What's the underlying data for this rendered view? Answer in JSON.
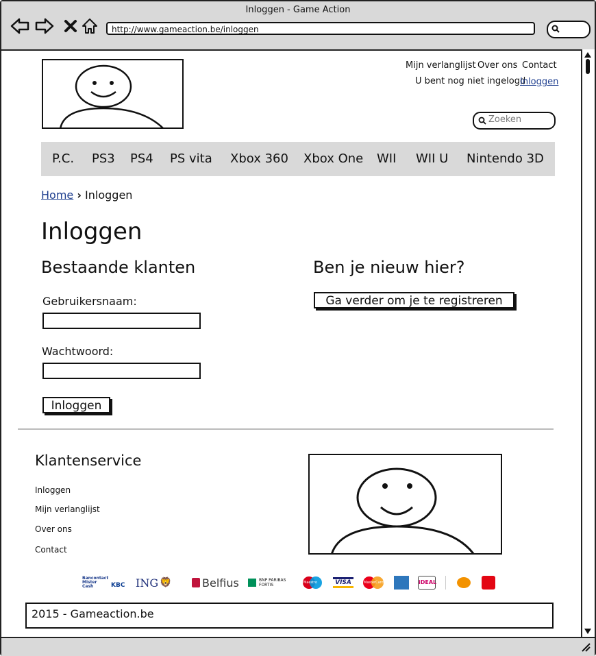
{
  "window": {
    "title": "Inloggen - Game Action"
  },
  "browser": {
    "url": "http://www.gameaction.be/inloggen"
  },
  "header": {
    "links": [
      "Mijn verlanglijst",
      "Over ons",
      "Contact"
    ],
    "login_status": "U bent nog niet ingelogd",
    "login_link": "Inloggen",
    "search_placeholder": "Zoeken"
  },
  "nav": {
    "items": [
      "P.C.",
      "PS3",
      "PS4",
      "PS vita",
      "Xbox 360",
      "Xbox One",
      "WII",
      "WII U",
      "Nintendo 3D"
    ]
  },
  "breadcrumb": {
    "home": "Home",
    "separator": "›",
    "current": "Inloggen"
  },
  "page": {
    "title": "Inloggen"
  },
  "login": {
    "heading": "Bestaande klanten",
    "username_label": "Gebruikersnaam:",
    "password_label": "Wachtwoord:",
    "submit_label": "Inloggen"
  },
  "register": {
    "heading": "Ben je nieuw hier?",
    "button_label": "Ga verder om je te registreren"
  },
  "footer": {
    "heading": "Klantenservice",
    "links": [
      "Inloggen",
      "Mijn verlanglijst",
      "Over ons",
      "Contact"
    ],
    "copyright": "2015 - Gameaction.be"
  },
  "payment_logos": {
    "bancontact": "Bancontact Mister Cash",
    "kbc": "KBC",
    "ing": "ING",
    "belfius": "Belfius",
    "bnp": "BNP PARIBAS FORTIS",
    "maestro": "Maestro",
    "visa": "VISA",
    "mastercard": "MasterCard",
    "ideal": "iDEAL"
  },
  "colors": {
    "chrome": "#d9d9d9",
    "nav_bg": "#d9d9d9",
    "link": "#1f3f8f"
  }
}
